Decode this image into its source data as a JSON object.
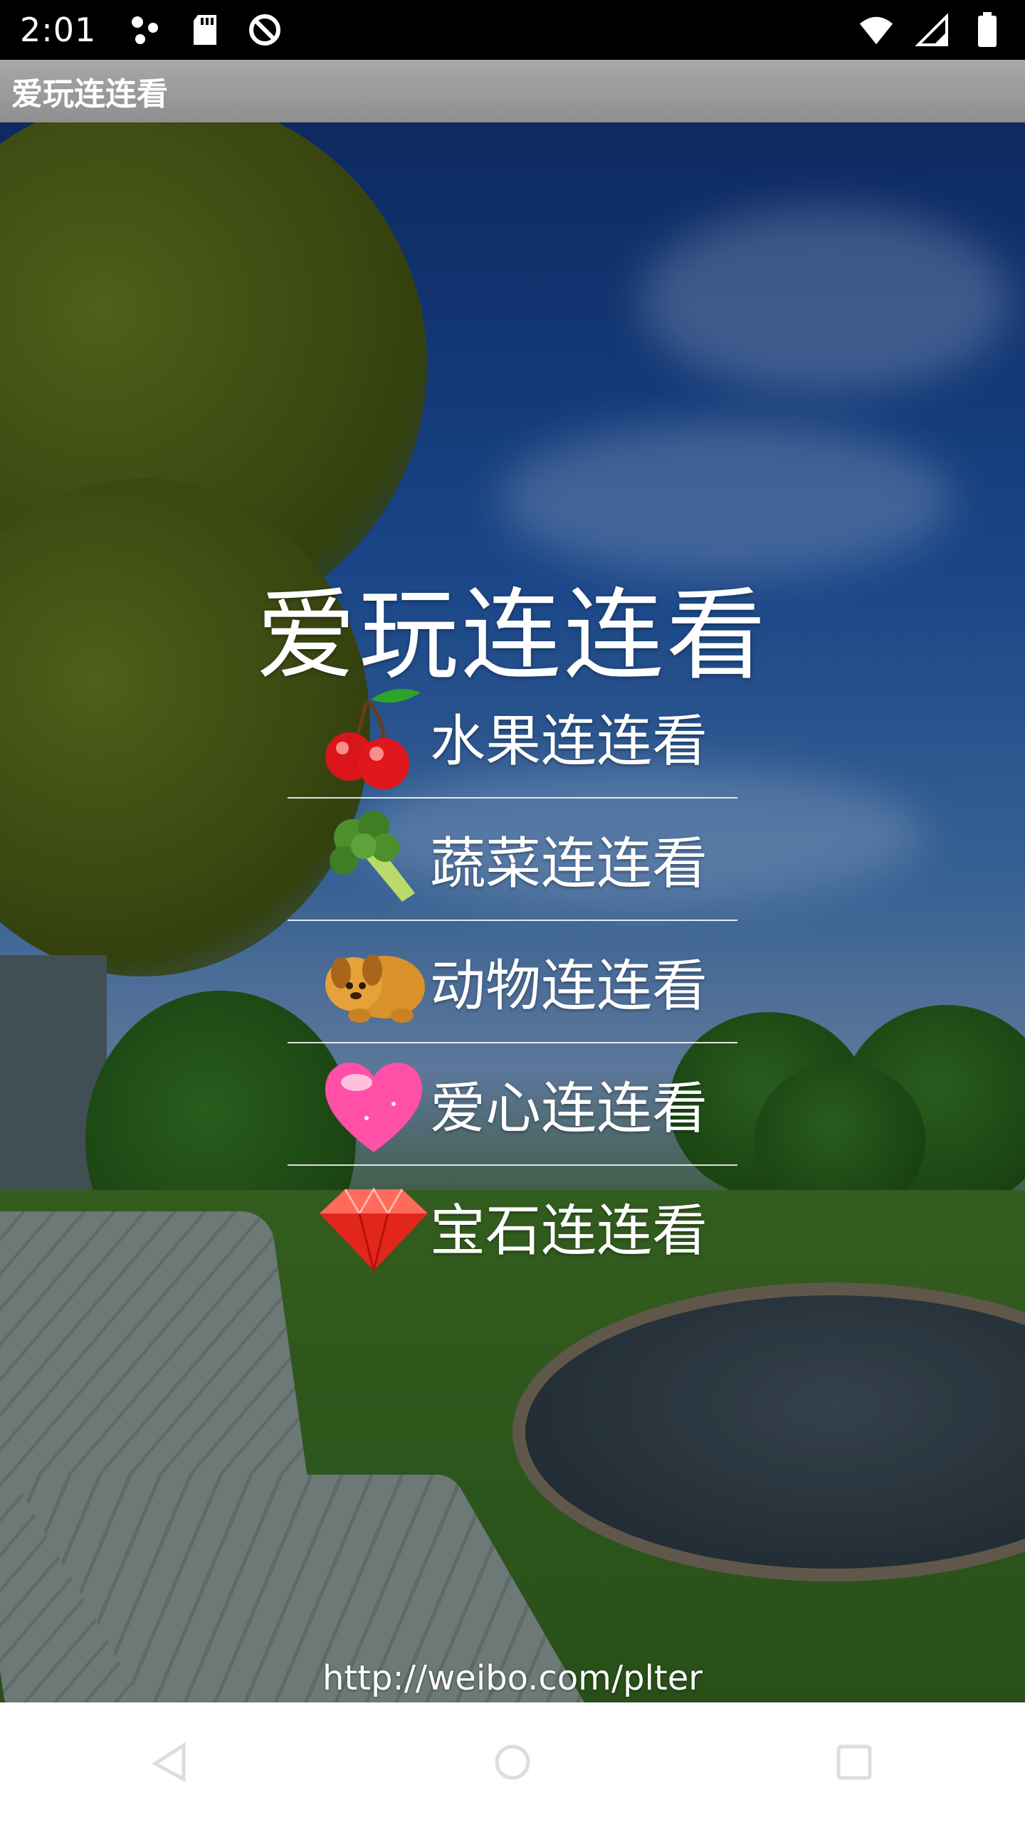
{
  "status_bar": {
    "time": "2:01",
    "icons_left": [
      "sync-icon",
      "sd-card-icon",
      "no-data-icon"
    ],
    "icons_right": [
      "wifi-icon",
      "signal-icon",
      "battery-icon"
    ]
  },
  "app_bar": {
    "title": "爱玩连连看"
  },
  "main": {
    "title": "爱玩连连看",
    "menu": [
      {
        "label": "水果连连看",
        "icon": "cherry-icon"
      },
      {
        "label": "蔬菜连连看",
        "icon": "broccoli-icon"
      },
      {
        "label": "动物连连看",
        "icon": "dog-icon"
      },
      {
        "label": "爱心连连看",
        "icon": "heart-icon"
      },
      {
        "label": "宝石连连看",
        "icon": "gem-icon"
      }
    ],
    "footer": "http://weibo.com/plter"
  },
  "nav_bar": {
    "buttons": [
      "back-icon",
      "home-icon",
      "recents-icon"
    ]
  },
  "colors": {
    "app_bar": "#9a9a9a",
    "text": "#ffffff",
    "nav_bar": "#ffffff"
  }
}
